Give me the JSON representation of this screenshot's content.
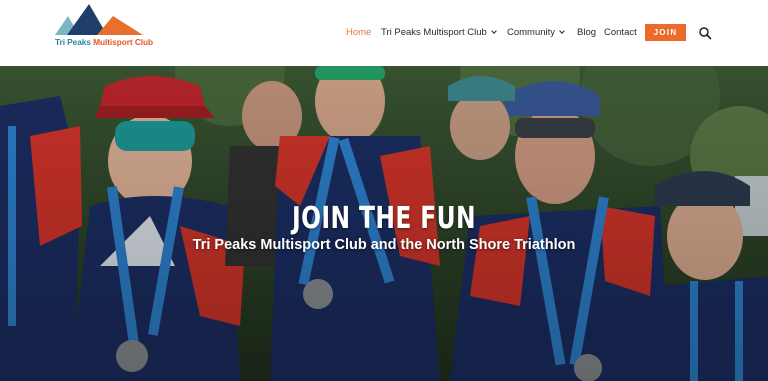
{
  "logo": {
    "text_part1": "Tri Peaks",
    "text_part2": "Multisport Club",
    "colors": {
      "peak_teal": "#7cb6c0",
      "peak_navy": "#1f3f6a",
      "peak_orange": "#e8702f"
    }
  },
  "nav": {
    "items": [
      {
        "label": "Home",
        "active": true
      },
      {
        "label": "Tri Peaks Multisport Club",
        "has_dropdown": true
      },
      {
        "label": "Community",
        "has_dropdown": true
      },
      {
        "label": "Blog"
      },
      {
        "label": "Contact"
      }
    ],
    "join_label": "JOIN",
    "search_icon": "search-icon"
  },
  "hero": {
    "title": "JOIN THE FUN",
    "subtitle": "Tri Peaks Multisport Club and the North Shore Triathlon"
  },
  "colors": {
    "accent": "#ec6a2a",
    "nav_active": "#e3773a",
    "jersey_navy": "#1c2f66",
    "jersey_red": "#d9362b",
    "medal_ribbon": "#2f86d6"
  }
}
